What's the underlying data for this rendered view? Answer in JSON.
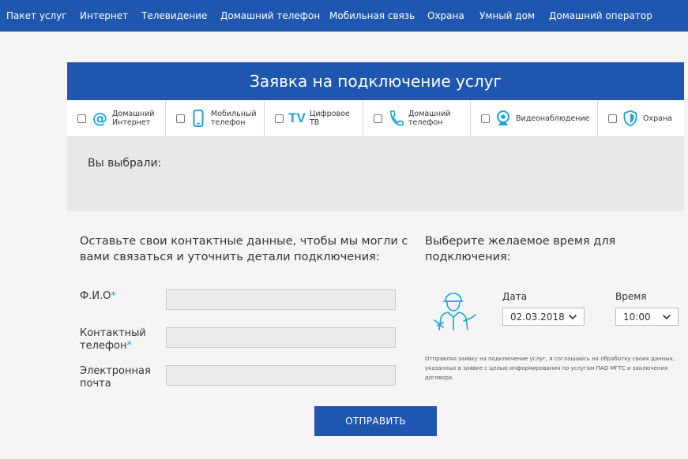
{
  "nav": {
    "items": [
      "Пакет услуг",
      "Интернет",
      "Телевидение",
      "Домашний телефон",
      "Мобильная связь",
      "Охрана",
      "Умный дом",
      "Домашний оператор"
    ]
  },
  "form": {
    "title": "Заявка на подключение услуг",
    "services": [
      {
        "label": "Домашний Интернет",
        "icon": "at-sign-icon"
      },
      {
        "label": "Мобильный телефон",
        "icon": "mobile-phone-icon"
      },
      {
        "label": "Цифровое ТВ",
        "icon": "tv-icon",
        "glyph": "TV"
      },
      {
        "label": "Домашний телефон",
        "icon": "handset-icon"
      },
      {
        "label": "Видеонаблюдение",
        "icon": "webcam-icon"
      },
      {
        "label": "Охрана",
        "icon": "shield-icon"
      }
    ],
    "selected_title": "Вы выбрали:",
    "contact_heading": "Оставьте свои контактные данные, чтобы мы могли с вами связаться и уточнить детали подключения:",
    "fields": {
      "name_label": "Ф.И.О",
      "phone_label_1": "Контактный",
      "phone_label_2": "телефон",
      "email_label_1": "Электронная",
      "email_label_2": "почта",
      "required_mark": "*",
      "name_value": "",
      "phone_value": "",
      "email_value": ""
    },
    "time_heading": "Выберите желаемое время для подключения:",
    "date_label": "Дата",
    "date_value": "02.03.2018",
    "time_label": "Время",
    "time_value": "10:00",
    "consent_text": "Отправляя заявку на подключение услуг, я соглашаюсь на обработку своих данных, указанных в заявке с целью информирования по услугам ПАО МГТС и заключения договора.",
    "submit_label": "ОТПРАВИТЬ"
  },
  "colors": {
    "brand_blue": "#1f57b0",
    "accent_cyan": "#1aa3dc",
    "panel_gray": "#e8e8e8"
  }
}
